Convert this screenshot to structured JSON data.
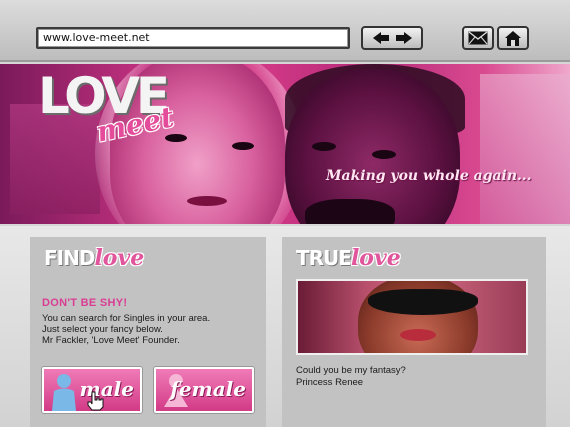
{
  "browser": {
    "url": "www.love-meet.net",
    "nav_icons": [
      "back-arrow-icon",
      "forward-arrow-icon"
    ],
    "mail_icon": "envelope-icon",
    "home_icon": "home-icon"
  },
  "banner": {
    "logo_word": "LOVE",
    "logo_sub": "meet",
    "tagline": "Making you whole again..."
  },
  "find_love": {
    "heading_a": "FIND",
    "heading_b": "love",
    "subheading": "DON'T BE SHY!",
    "lines": [
      "You can search for Singles in your area.",
      "Just select your fancy below.",
      "Mr Fackler, 'Love Meet' Founder."
    ],
    "buttons": [
      {
        "label": "male"
      },
      {
        "label": "female"
      }
    ]
  },
  "true_love": {
    "heading_a": "TRUE",
    "heading_b": "love",
    "caption_lines": [
      "Could you be my fantasy?",
      "Princess Renee"
    ]
  },
  "colors": {
    "accent_pink": "#d93d93",
    "banner_pink": "#c0307e"
  }
}
